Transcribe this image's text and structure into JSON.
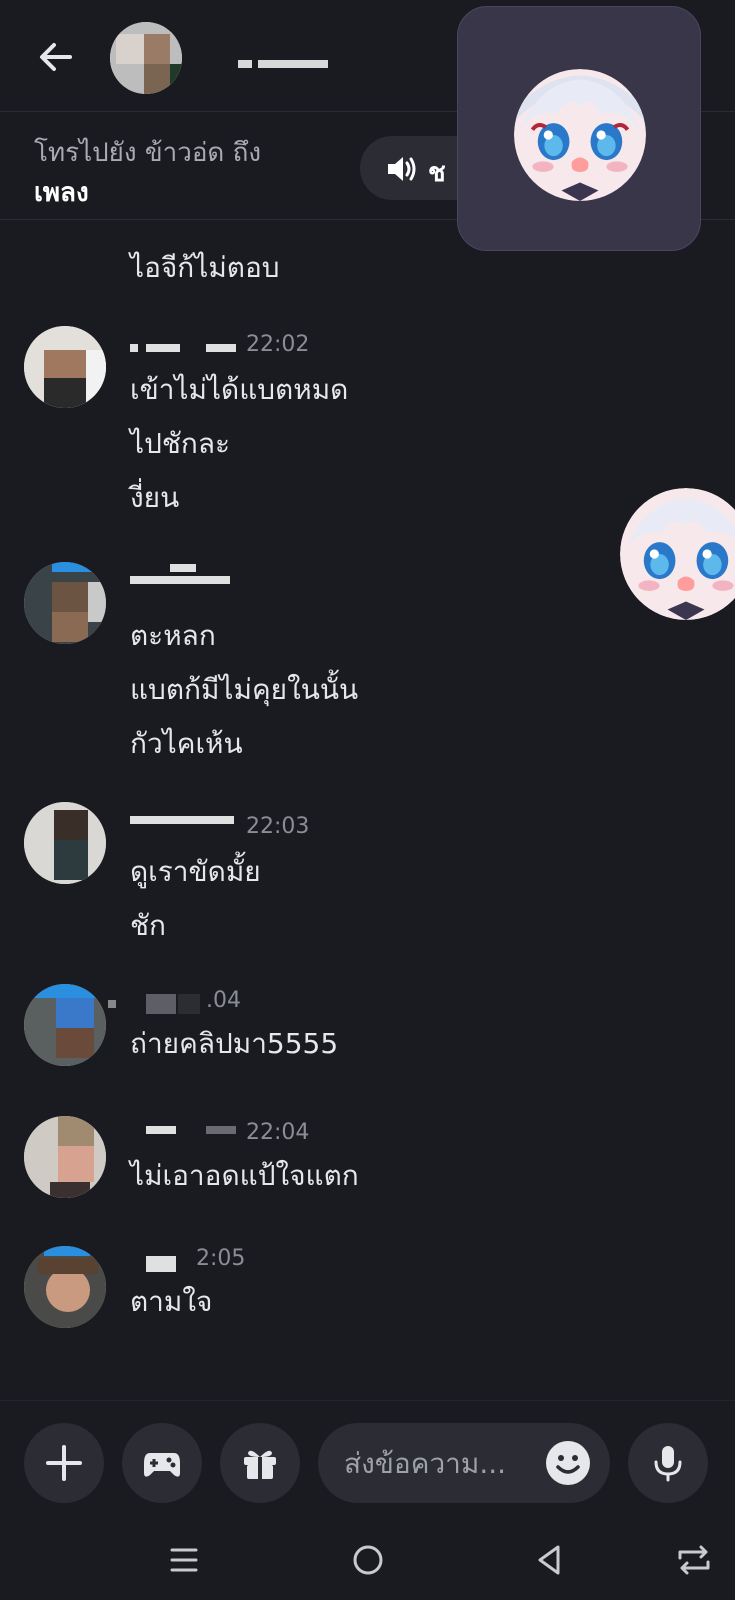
{
  "header": {
    "back_icon": "arrow-left-icon"
  },
  "call_bar": {
    "line1": "โทรไปยัง ข้าวอ่ด ถึง",
    "line2": "เพลง",
    "sound_label": "ช",
    "sound_icon": "speaker-icon"
  },
  "messages": [
    {
      "time": "",
      "lines": [
        "ไอจีก้ไม่ตอบ"
      ]
    },
    {
      "time": "22:02",
      "lines": [
        "เข้าไม่ได้แบตหมด",
        "ไปชักละ",
        "งี่ยน"
      ]
    },
    {
      "time": "",
      "lines": [
        "ตะหลก",
        "แบตก้มีไม่คุยในนั้น",
        "กัวไคเห้น"
      ]
    },
    {
      "time": "22:03",
      "lines": [
        "ดูเราขัดมั้ย",
        "ชัก"
      ]
    },
    {
      "time": ".04",
      "lines": [
        "ถ่ายคลิปมา5555"
      ]
    },
    {
      "time": "22:04",
      "lines": [
        "ไม่เอาอดแป้ใจแตก"
      ]
    },
    {
      "time": "2:05",
      "lines": [
        "ตามใจ"
      ]
    }
  ],
  "input": {
    "placeholder": "ส่งข้อความ...",
    "add_icon": "plus-icon",
    "game_icon": "gamepad-icon",
    "gift_icon": "gift-icon",
    "emoji_icon": "emoji-icon",
    "mic_icon": "microphone-icon"
  },
  "navbar": {
    "icons": [
      "menu-icon",
      "home-icon",
      "back-triangle-icon",
      "rotate-icon"
    ]
  },
  "colors": {
    "background": "#1a1b21",
    "overlay": "#3a3649",
    "pill": "#2b2c34",
    "text": "#e6e7ea",
    "muted": "#8b8d95"
  }
}
